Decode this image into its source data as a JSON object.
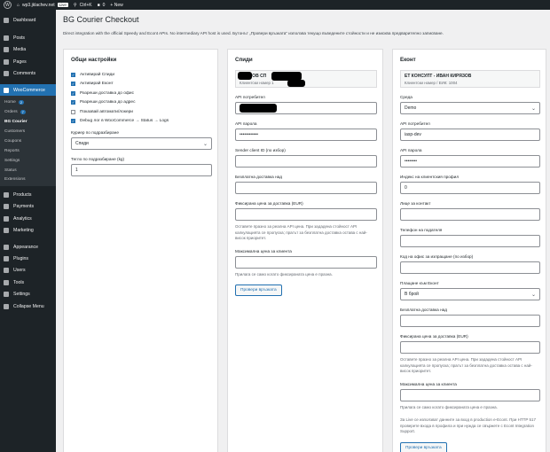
{
  "adminbar": {
    "site": "wp3.jklachev.net",
    "live": "Live",
    "shortcut": "Ctrl+K",
    "comments": "0",
    "new": "+ New"
  },
  "sidebar": {
    "top": [
      {
        "label": "Dashboard",
        "icon": "dashboard-icon"
      }
    ],
    "group1": [
      {
        "label": "Posts",
        "icon": "pin-icon"
      },
      {
        "label": "Media",
        "icon": "media-icon"
      },
      {
        "label": "Pages",
        "icon": "page-icon"
      },
      {
        "label": "Comments",
        "icon": "comment-icon"
      }
    ],
    "woo": {
      "label": "WooCommerce",
      "icon": "woo-icon"
    },
    "sub": [
      {
        "label": "Home",
        "count": "2"
      },
      {
        "label": "Orders",
        "count": "7"
      },
      {
        "label": "BG Courier",
        "count": ""
      },
      {
        "label": "Customers",
        "count": ""
      },
      {
        "label": "Coupons",
        "count": ""
      },
      {
        "label": "Reports",
        "count": ""
      },
      {
        "label": "Settings",
        "count": ""
      },
      {
        "label": "Status",
        "count": ""
      },
      {
        "label": "Extensions",
        "count": ""
      }
    ],
    "group2": [
      {
        "label": "Products",
        "icon": "archive-icon"
      },
      {
        "label": "Payments",
        "icon": "payment-icon"
      },
      {
        "label": "Analytics",
        "icon": "chart-icon"
      },
      {
        "label": "Marketing",
        "icon": "megaphone-icon"
      }
    ],
    "group3": [
      {
        "label": "Appearance",
        "icon": "brush-icon"
      },
      {
        "label": "Plugins",
        "icon": "plugin-icon"
      },
      {
        "label": "Users",
        "icon": "users-icon"
      },
      {
        "label": "Tools",
        "icon": "wrench-icon"
      },
      {
        "label": "Settings",
        "icon": "settings-icon"
      },
      {
        "label": "Collapse Menu",
        "icon": "collapse-icon"
      }
    ]
  },
  "page": {
    "title": "BG Courier Checkout",
    "description": "Direct integration with the official Speedy and Econt APIs. No intermediary API host is used. Бутонът „Провери връзката“ използва текущо въведените стойности и не изисква предварително записване."
  },
  "general": {
    "title": "Общи настройки",
    "checks": [
      {
        "label": "Активирай Спиди",
        "checked": true
      },
      {
        "label": "Активирай Еконт",
        "checked": true
      },
      {
        "label": "Разреши доставка до офис",
        "checked": true
      },
      {
        "label": "Разреши доставка до адрес",
        "checked": true
      },
      {
        "label": "Показвай автомати/локери",
        "checked": false
      },
      {
        "label": "Debug лог в WooCommerce → Status → Logs",
        "checked": true
      }
    ],
    "courier_label": "Куриер по подразбиране",
    "courier_value": "Спиди",
    "weight_label": "Тегло по подразбиране (kg)",
    "weight_value": "1"
  },
  "speedy": {
    "title": "Спиди",
    "info_title": "ИВАНОВ СП",
    "info_sub": "Клиентски номер 1",
    "api_user_label": "API потребител",
    "api_pass_label": "API парола",
    "api_pass_value": "••••••••••••",
    "sender_label": "Sender client ID (по избор)",
    "free_label": "Безплатна доставка над",
    "fixed_label": "Фиксирана цена за доставка (EUR)",
    "fixed_help": "Оставете празно за реална API цена. При зададена стойност API калкулацията се пропуска; прагът за безплатна доставка остава с най-висок приоритет.",
    "max_label": "Максимална цена за клиента",
    "max_help": "Прилага се само когато фиксираната цена е празна.",
    "test_button": "Провери връзката"
  },
  "econt": {
    "title": "Еконт",
    "info_title": "ЕТ КОНСУЛТ - ИВАН КИРЯЗОВ",
    "info_sub": "Клиентски номер / ЕИК: 1004",
    "env_label": "Среда",
    "env_value": "Demo",
    "api_user_label": "API потребител",
    "api_user_value": "iasp-dev",
    "api_pass_label": "API парола",
    "api_pass_value": "••••••••",
    "cid_label": "Индекс на клиентския профил",
    "cid_value": "0",
    "contact_label": "Лице за контакт",
    "phone_label": "Телефон на подателя",
    "office_label": "Код на офис за изпращане (по избор)",
    "pay_label": "Плащане към Еконт",
    "pay_value": "В брой",
    "free_label": "Безплатна доставка над",
    "fixed_label": "Фиксирана цена за доставка (EUR)",
    "fixed_help": "Оставете празно за реална API цена. При зададена стойност API калкулацията се пропуска; прагът за безплатна доставка остава с най-висок приоритет.",
    "max_label": "Максимална цена за клиента",
    "max_help": "Прилага се само когато фиксираната цена е празна.",
    "live_help": "За Live се използват данните за вход в production e-Econt. При HTTP 517 проверете входа в профила и при нужда се свържете с Econt Integration Support.",
    "test_button": "Провери връзката"
  }
}
